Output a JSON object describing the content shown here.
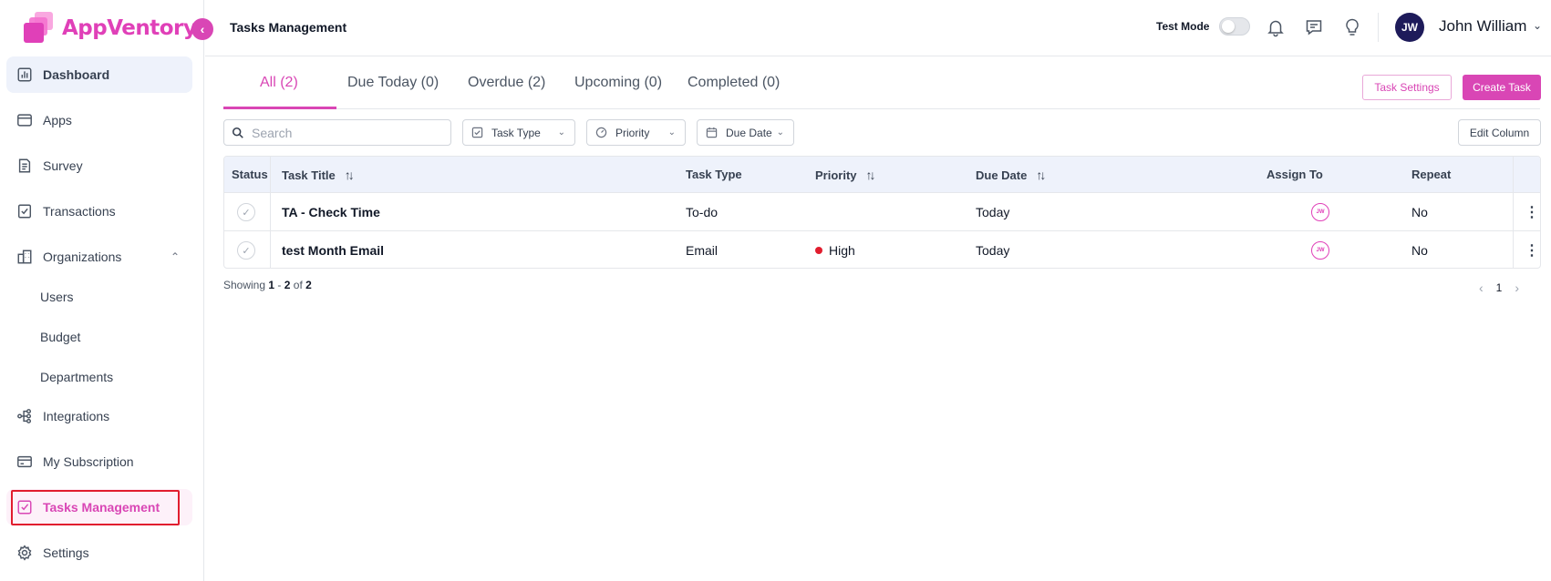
{
  "app": {
    "name": "AppVentory"
  },
  "sidebar": {
    "items": [
      {
        "label": "Dashboard"
      },
      {
        "label": "Apps"
      },
      {
        "label": "Survey"
      },
      {
        "label": "Transactions"
      },
      {
        "label": "Organizations"
      },
      {
        "label": "Users"
      },
      {
        "label": "Budget"
      },
      {
        "label": "Departments"
      },
      {
        "label": "Integrations"
      },
      {
        "label": "My Subscription"
      },
      {
        "label": "Tasks Management"
      },
      {
        "label": "Settings"
      }
    ]
  },
  "header": {
    "title": "Tasks Management",
    "test_mode_label": "Test Mode",
    "user_initials": "JW",
    "user_name": "John William"
  },
  "tabs": [
    {
      "label": "All (2)"
    },
    {
      "label": "Due Today (0)"
    },
    {
      "label": "Overdue (2)"
    },
    {
      "label": "Upcoming (0)"
    },
    {
      "label": "Completed (0)"
    }
  ],
  "actions": {
    "task_settings": "Task Settings",
    "create_task": "Create Task",
    "edit_column": "Edit Column"
  },
  "filters": {
    "search_placeholder": "Search",
    "task_type": "Task Type",
    "priority": "Priority",
    "due_date": "Due Date"
  },
  "table": {
    "columns": [
      "Status",
      "Task Title",
      "Task Type",
      "Priority",
      "Due Date",
      "Assign To",
      "Repeat"
    ],
    "rows": [
      {
        "title": "TA - Check Time",
        "type": "To-do",
        "priority": "",
        "due": "Today",
        "assignee": "JW",
        "repeat": "No"
      },
      {
        "title": "test Month Email",
        "type": "Email",
        "priority": "High",
        "due": "Today",
        "assignee": "JW",
        "repeat": "No"
      }
    ]
  },
  "pagination": {
    "showing_prefix": "Showing",
    "range_start": "1",
    "range_sep": "-",
    "range_end": "2",
    "of_label": "of",
    "total": "2",
    "current_page": "1"
  },
  "colors": {
    "brand": "#d946b5",
    "priority_high": "#e11d2e",
    "avatar_bg": "#1e1b5a"
  }
}
